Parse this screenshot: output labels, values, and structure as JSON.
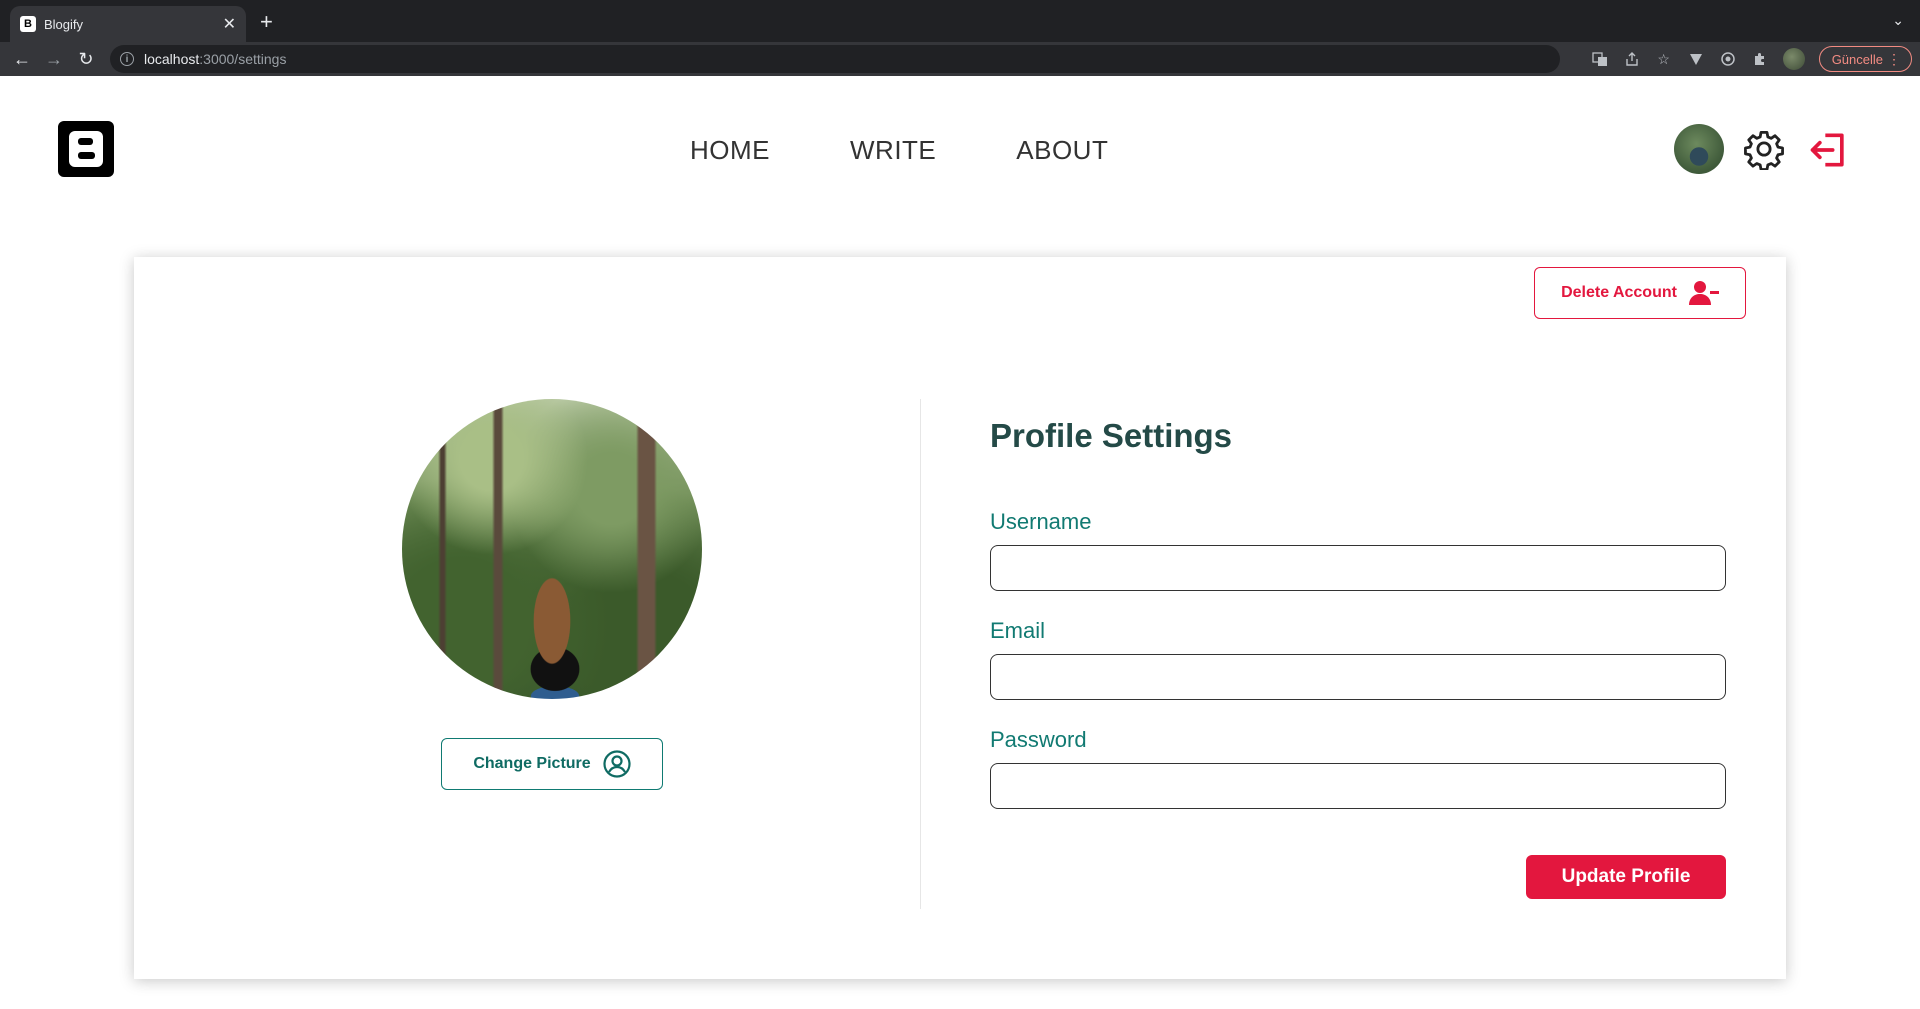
{
  "browser": {
    "tab_title": "Blogify",
    "tab_favicon": "B",
    "tab_close": "✕",
    "new_tab": "+",
    "url_host": "localhost",
    "url_path": ":3000/settings",
    "update_label": "Güncelle",
    "icons": [
      "translate-icon",
      "share-icon",
      "star-icon",
      "extension-v-icon",
      "extension-target-icon",
      "puzzle-icon",
      "profile-avatar"
    ]
  },
  "header": {
    "logo_letter": "B",
    "nav": [
      "HOME",
      "WRITE",
      "ABOUT"
    ],
    "icons": [
      "avatar",
      "gear-icon",
      "logout-icon"
    ]
  },
  "settings": {
    "delete_account_label": "Delete Account",
    "change_picture_label": "Change Picture",
    "title": "Profile Settings",
    "fields": {
      "username_label": "Username",
      "email_label": "Email",
      "password_label": "Password",
      "username_value": "",
      "email_value": "",
      "password_value": ""
    },
    "update_label": "Update Profile"
  },
  "colors": {
    "accent_red": "#e3173e",
    "accent_teal": "#117a72",
    "title_dark_teal": "#244a47"
  }
}
